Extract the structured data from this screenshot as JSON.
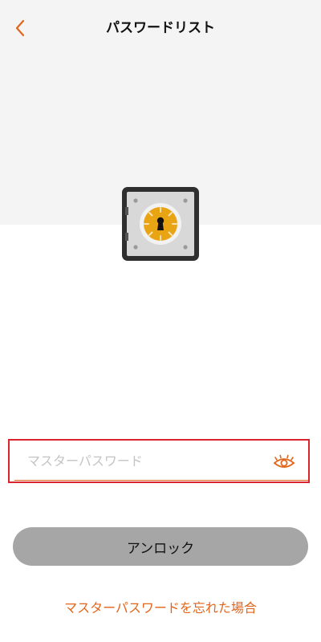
{
  "header": {
    "title": "パスワードリスト",
    "back_icon": "chevron-left-icon"
  },
  "hero": {
    "icon": "safe-lock-icon"
  },
  "form": {
    "password_placeholder": "マスターパスワード",
    "password_value": "",
    "visibility_icon": "eye-icon"
  },
  "actions": {
    "unlock_label": "アンロック",
    "forgot_label": "マスターパスワードを忘れた場合"
  },
  "colors": {
    "accent": "#e1661c",
    "highlight_border": "#d9232d",
    "button_bg": "#a6a6a6",
    "hero_bg": "#f4f4f4",
    "safe_dial": "#e8a413"
  }
}
